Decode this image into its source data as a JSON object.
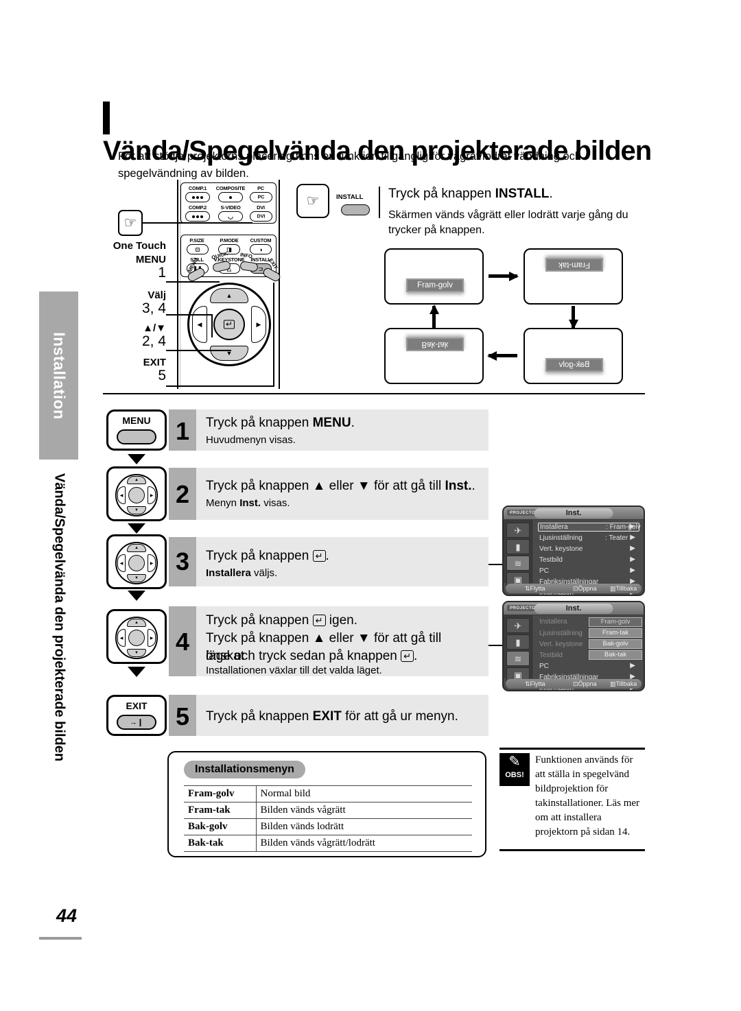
{
  "sidebar": {
    "tab_label": "Installation",
    "chapter_label": "Vända/Spegelvända den projekterade bilden"
  },
  "header": {
    "title": "Vända/Spegelvända den projekterade bilden",
    "intro": "För att stödja projektorns placering finns en funktion tillgänglig för vågrät/lodrät vändning och spegelvändning av bilden."
  },
  "remote": {
    "one_touch_label": "One Touch",
    "callouts": [
      {
        "label": "MENU",
        "num": "1"
      },
      {
        "label": "Välj",
        "num": "3, 4"
      },
      {
        "label": "▲/▼",
        "num": "2, 4"
      },
      {
        "label": "EXIT",
        "num": "5"
      }
    ],
    "source_buttons": [
      "COMP.1",
      "COMPOSITE",
      "PC",
      "COMP.2",
      "S-VIDEO",
      "DVI"
    ],
    "func_buttons": [
      "P.SIZE",
      "P.MODE",
      "CUSTOM",
      "STILL",
      "V.KEYSTONE",
      "INSTALL"
    ],
    "small_buttons": [
      "MENU",
      "QUICK",
      "INFO",
      "EXIT"
    ],
    "pc_glyph": "PC",
    "dvi_glyph": "DVI",
    "highlighted_button": "INSTALL"
  },
  "install": {
    "key_label": "INSTALL",
    "heading_pre": "Tryck på knappen ",
    "heading_strong": "INSTALL",
    "heading_post": ".",
    "sub": "Skärmen vänds vågrätt eller lodrätt varje gång du trycker på knappen."
  },
  "flip_diagram": {
    "screens": [
      {
        "label": "Fram-golv",
        "orientation": "normal"
      },
      {
        "label": "Fram-tak",
        "orientation": "rotate-180"
      },
      {
        "label": "Bak-golv",
        "orientation": "flip-horizontal"
      },
      {
        "label": "Bak-tak",
        "orientation": "flip-vertical"
      }
    ]
  },
  "steps": [
    {
      "num": "1",
      "key": "MENU",
      "main_pre": "Tryck på knappen ",
      "main_strong": "MENU",
      "main_post": ".",
      "sub": "Huvudmenyn visas."
    },
    {
      "num": "2",
      "key": "dpad",
      "main_pre": "Tryck på knappen ▲ eller ▼ för att gå till ",
      "main_strong": "Inst.",
      "main_post": ".",
      "sub_pre": "Menyn ",
      "sub_strong": "Inst.",
      "sub_post": " visas."
    },
    {
      "num": "3",
      "key": "dpad",
      "main_pre": "Tryck på knappen ",
      "main_key": "↵",
      "main_post": ".",
      "sub_strong": "Installera",
      "sub_post": " väljs."
    },
    {
      "num": "4",
      "key": "dpad",
      "line1_pre": "Tryck på knappen ",
      "line1_key": "↵",
      "line1_post": " igen.",
      "line2": "Tryck på knappen ▲ eller ▼ för att gå till önskat",
      "line3_pre": "läge och tryck sedan på knappen ",
      "line3_key": "↵",
      "line3_post": ".",
      "sub": "Installationen växlar till det valda läget."
    },
    {
      "num": "5",
      "key": "EXIT",
      "main_pre": "Tryck på knappen ",
      "main_strong": "EXIT",
      "main_post": " för att gå ur menyn."
    }
  ],
  "osd": {
    "brand": "PROJECTOR",
    "title": "Inst.",
    "rows": [
      {
        "label": "Installera",
        "sep": ":",
        "value": "Fram-golv"
      },
      {
        "label": "Ljusinställning",
        "sep": ":",
        "value": "Teater"
      },
      {
        "label": "Vert. keystone",
        "sep": "",
        "value": ""
      },
      {
        "label": "Testbild",
        "sep": "",
        "value": ""
      },
      {
        "label": "PC",
        "sep": "",
        "value": ""
      },
      {
        "label": "Fabriksinställningar",
        "sep": "",
        "value": ""
      },
      {
        "label": "Information",
        "sep": "",
        "value": ""
      }
    ],
    "popup_options": [
      "Fram-golv",
      "Fram-tak",
      "Bak-golv",
      "Bak-tak"
    ],
    "popup_selected": "Fram-golv",
    "footer": {
      "move": "Flytta",
      "open": "Öppna",
      "back": "Tillbaka"
    }
  },
  "table": {
    "badge": "Installationsmenyn",
    "rows": [
      {
        "mode": "Fram-golv",
        "desc": "Normal bild"
      },
      {
        "mode": "Fram-tak",
        "desc": "Bilden vänds vågrätt"
      },
      {
        "mode": "Bak-golv",
        "desc": "Bilden vänds lodrätt"
      },
      {
        "mode": "Bak-tak",
        "desc": "Bilden vänds vågrätt/lodrätt"
      }
    ]
  },
  "note": {
    "badge": "OBS!",
    "text": "Funktionen används för att ställa in spegelvänd bildprojektion för takinstallationer. Läs mer om att installera projektorn på sidan 14."
  },
  "footer": {
    "page_number": "44"
  }
}
